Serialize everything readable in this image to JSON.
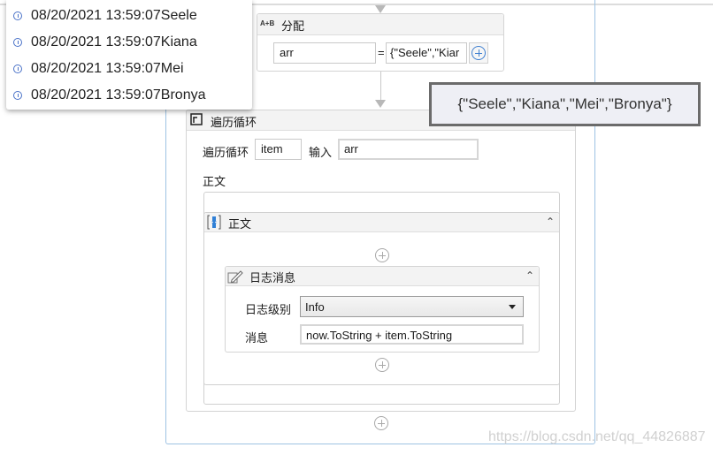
{
  "log_output": {
    "entries": [
      {
        "level": "info",
        "icon": "info-icon",
        "text": "08/20/2021 13:59:07Seele"
      },
      {
        "level": "info",
        "icon": "info-icon",
        "text": "08/20/2021 13:59:07Kiana"
      },
      {
        "level": "info",
        "icon": "info-icon",
        "text": "08/20/2021 13:59:07Mei"
      },
      {
        "level": "info",
        "icon": "info-icon",
        "text": "08/20/2021 13:59:07Bronya"
      }
    ]
  },
  "assign": {
    "icon": "assign-icon",
    "icon_text": "A+B",
    "title": "分配",
    "target": "arr",
    "equals": "=",
    "value": "{\"Seele\",\"Kiar"
  },
  "tooltip": {
    "text": "{\"Seele\",\"Kiana\",\"Mei\",\"Bronya\"}"
  },
  "foreach": {
    "icon": "foreach-icon",
    "title": "遍历循环",
    "item_label": "遍历循环",
    "item_value": "item",
    "input_label": "输入",
    "input_value": "arr",
    "body_label": "正文"
  },
  "body_sequence": {
    "icon": "sequence-icon",
    "title": "正文"
  },
  "log_message": {
    "icon": "log-message-icon",
    "title": "日志消息",
    "level_label": "日志级别",
    "level_value": "Info",
    "message_label": "消息",
    "message_value": "now.ToString + item.ToString"
  },
  "watermark": "https://blog.csdn.net/qq_44826887"
}
